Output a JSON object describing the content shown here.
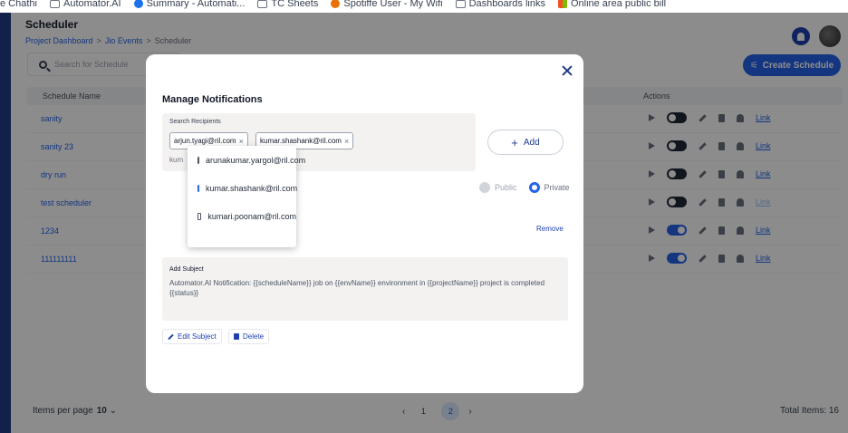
{
  "bookmarks": [
    {
      "label": "e Chathi",
      "icon": "none"
    },
    {
      "label": "Automator.AI",
      "icon": "folder-icon"
    },
    {
      "label": "Summary - Automati...",
      "icon": "chrome-icon"
    },
    {
      "label": "TC Sheets",
      "icon": "folder-icon"
    },
    {
      "label": "Spotiffe User - My Wifi",
      "icon": "orange-icon"
    },
    {
      "label": "Dashboards links",
      "icon": "folder-icon"
    },
    {
      "label": "Online area public bill",
      "icon": "microsoft-icon"
    }
  ],
  "header": {
    "title": "Scheduler",
    "crumb_1": "Project Dashboard",
    "crumb_2": "Jio Events",
    "crumb_3": "Scheduler",
    "sep": ">"
  },
  "toolbar": {
    "search_placeholder": "Search for Schedule",
    "create_label": "Create Schedule"
  },
  "table": {
    "col_name": "Schedule Name",
    "col_actions": "Actions",
    "rows": [
      {
        "name": "sanity",
        "toggle_on": false,
        "link": "Link"
      },
      {
        "name": "sanity 23",
        "toggle_on": false,
        "link": "Link"
      },
      {
        "name": "dry run",
        "toggle_on": false,
        "link": "Link"
      },
      {
        "name": "test scheduler",
        "toggle_on": false,
        "link": "Link"
      },
      {
        "name": "1234",
        "toggle_on": true,
        "link": "Link"
      },
      {
        "name": "111111111",
        "toggle_on": true,
        "link": "Link"
      }
    ]
  },
  "footer": {
    "items_per_page_label": "Items per page",
    "items_per_page_value": "10",
    "prev": "‹",
    "page_1": "1",
    "page_2": "2",
    "next": "›",
    "current_page": 2,
    "total": "Total Items: 16"
  },
  "modal": {
    "title": "Manage Notifications",
    "search_label": "Search Recipients",
    "chips": [
      "arjun.tyagi@ril.com",
      "kumar.shashank@ril.com"
    ],
    "chip_remove": "×",
    "typed_value": "kum",
    "add_label": "Add",
    "options": [
      {
        "email": "arunakumar.yargol@ril.com",
        "checked": false
      },
      {
        "email": "kumar.shashank@ril.com",
        "checked": true
      },
      {
        "email": "kumari.poonam@ril.com",
        "checked": false
      }
    ],
    "public_label": "Public",
    "private_label": "Private",
    "visibility": "Private",
    "remove_label": "Remove",
    "subject_label": "Add Subject",
    "subject_text": "Automator.AI Notification: {{scheduleName}} job on {{envName}} environment in {{projectName}} project is completed {{status}}",
    "edit_subject_label": "Edit Subject",
    "delete_label": "Delete"
  },
  "colors": {
    "primary": "#2563eb",
    "nav": "#243b86",
    "overlay": "rgba(0,0,0,0.45)"
  }
}
